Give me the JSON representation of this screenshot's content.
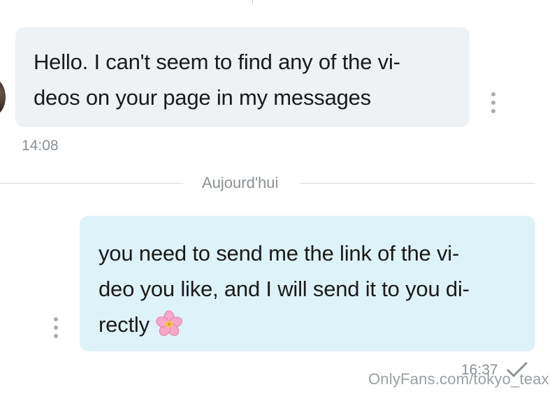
{
  "conversation": {
    "messages": [
      {
        "direction": "incoming",
        "lines": [
          "Hello. I can't seem to find any of the vi-",
          "deos on your page in my messages"
        ],
        "time": "14:08"
      },
      {
        "direction": "outgoing",
        "lines": [
          "you need to send me the link of the vi-",
          "deo you like, and I will send it to you di-",
          "rectly"
        ],
        "emoji_icon": "cherry-blossom-emoji",
        "time": "16:37",
        "status_icon": "checkmark-icon"
      }
    ],
    "date_divider": "Aujourd'hui"
  },
  "watermark": "OnlyFans.com/tokyo_teax",
  "colors": {
    "incoming_bubble": "#eef2f4",
    "outgoing_bubble": "#def2f9",
    "meta_text": "#8a9096"
  }
}
